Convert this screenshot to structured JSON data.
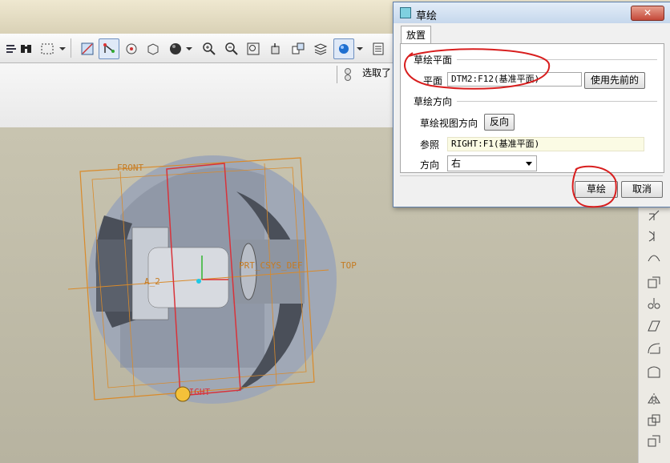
{
  "dialog": {
    "title": "草绘",
    "close_label": "✕",
    "tab_label": "放置",
    "sketch_plane": {
      "group_title": "草绘平面",
      "plane_label": "平面",
      "plane_value": "DTM2:F12(基准平面)",
      "use_previous_label": "使用先前的"
    },
    "sketch_orientation": {
      "group_title": "草绘方向",
      "view_direction_label": "草绘视图方向",
      "flip_label": "反向",
      "reference_label": "参照",
      "reference_value": "RIGHT:F1(基准平面)",
      "orientation_label": "方向",
      "orientation_value": "右"
    },
    "sketch_button_label": "草绘",
    "cancel_button_label": "取消"
  },
  "toolbar": {
    "select_label": "选取了"
  },
  "model_labels": {
    "front": "FRONT",
    "top": "TOP",
    "right": "RIGHT",
    "csys": "PRT_CSYS_DEF",
    "axis": "A_2"
  },
  "colors": {
    "datum_orange": "#d98a2a",
    "datum_red": "#d8333a",
    "annotation_red": "#d81e1e",
    "model_gray": "#9aa3b3",
    "dialog_border": "#5f7ea8"
  }
}
